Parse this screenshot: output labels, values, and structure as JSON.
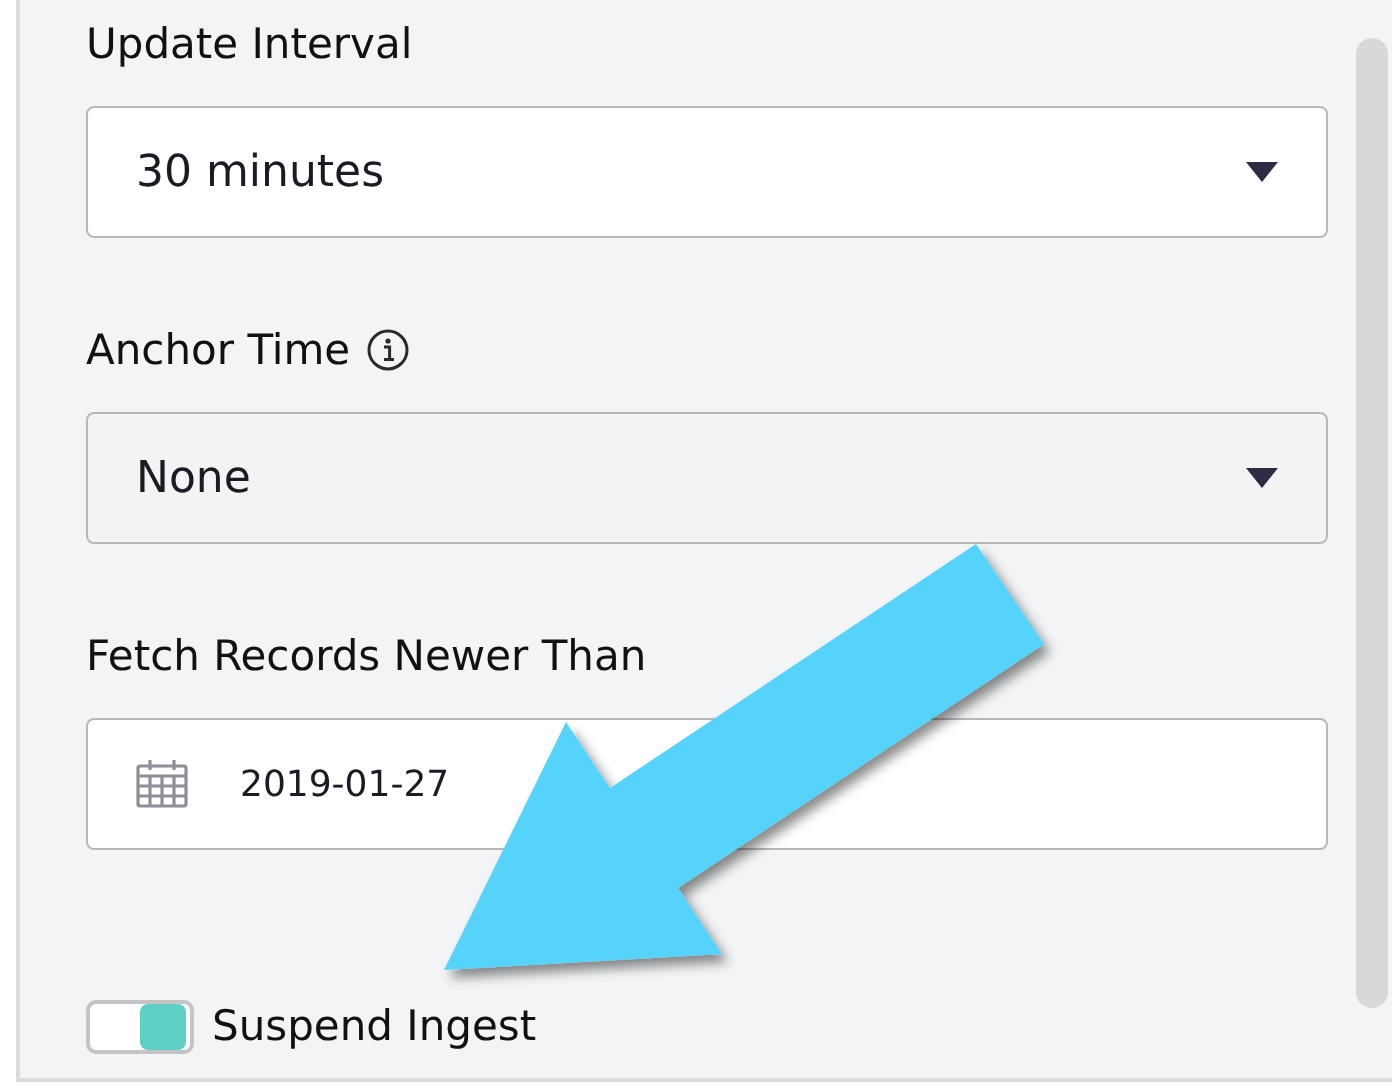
{
  "fields": [
    {
      "kind": "select",
      "label": "Update Interval",
      "value": "30 minutes",
      "disabled": false
    },
    {
      "kind": "select",
      "label": "Anchor Time",
      "info": true,
      "value": "None",
      "disabled": true
    },
    {
      "kind": "date",
      "label": "Fetch Records Newer Than",
      "value": "2019-01-27"
    }
  ],
  "toggle": {
    "label": "Suspend Ingest",
    "on": true
  }
}
